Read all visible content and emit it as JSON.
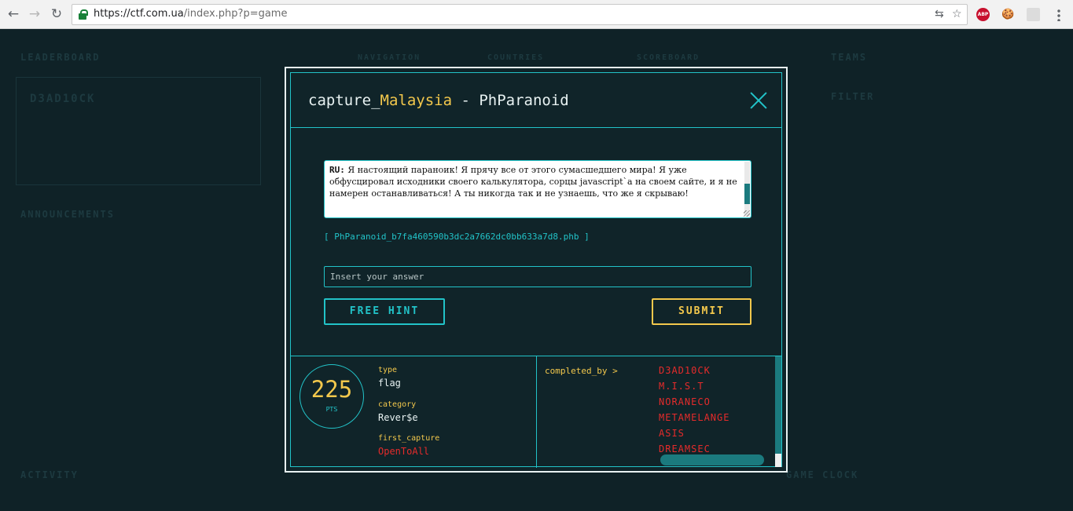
{
  "browser": {
    "url_scheme_host": "https://ctf.com.ua",
    "url_rest": "/index.php?p=game",
    "back_glyph": "←",
    "forward_glyph": "→",
    "reload_glyph": "↻",
    "translate_glyph": "⇆",
    "star_glyph": "☆",
    "ext_abp": "ABP",
    "ext_cookie": "🍪"
  },
  "background": {
    "leaderboard": "LEADERBOARD",
    "navigation": "NAVIGATION",
    "countries": "COUNTRIES",
    "scoreboard": "SCOREBOARD",
    "teams": "TEAMS",
    "filter": "FILTER",
    "announcements": "ANNOUNCEMENTS",
    "activity": "ACTIVITY",
    "game_clock": "GAME CLOCK",
    "team_name": "D3AD10CK"
  },
  "modal": {
    "title_prefix": "capture_",
    "title_country": "Malaysia",
    "title_sep": " - ",
    "title_challenge": "PhParanoid",
    "description_lang": "RU:",
    "description_text": " Я настоящий параноик! Я прячу все от этого сумасшедшего мира! Я уже обфусцировал исходники своего калькулятора, сорцы javascript`а на своем сайте, и я не намерен останавливаться! А ты никогда так и не узнаешь, что же я скрываю!",
    "file_link": "[ PhParanoid_b7fa460590b3dc2a7662dc0bb633a7d8.phb ]",
    "answer_placeholder": "Insert your answer",
    "free_hint_label": "FREE HINT",
    "submit_label": "SUBMIT",
    "points_value": "225",
    "points_unit": "PTS",
    "type_key": "type",
    "type_value": "flag",
    "category_key": "category",
    "category_value": "Rever$e",
    "first_capture_key": "first_capture",
    "first_capture_value": "OpenToAll",
    "completed_by_key": "completed_by >",
    "completed_by": [
      "D3AD10CK",
      "M.I.S.T",
      "NORANECO",
      "METAMELANGE",
      "ASIS",
      "DREAMSEC"
    ]
  },
  "colors": {
    "accent_cyan": "#22c3c8",
    "accent_yellow": "#f3c84c",
    "accent_red": "#e52b2b",
    "panel_bg": "#102429"
  }
}
